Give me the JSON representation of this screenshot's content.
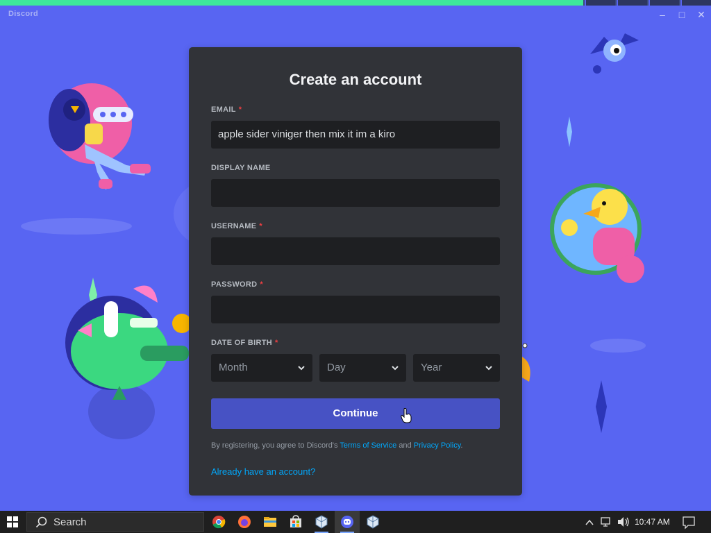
{
  "app": {
    "name": "Discord"
  },
  "form": {
    "title": "Create an account",
    "email": {
      "label": "EMAIL",
      "required_mark": "*",
      "value": "apple sider viniger then mix it im a kiro"
    },
    "display_name": {
      "label": "DISPLAY NAME",
      "value": ""
    },
    "username": {
      "label": "USERNAME",
      "required_mark": "*",
      "value": ""
    },
    "password": {
      "label": "PASSWORD",
      "required_mark": "*",
      "value": ""
    },
    "date_of_birth": {
      "label": "DATE OF BIRTH",
      "required_mark": "*",
      "month": "Month",
      "day": "Day",
      "year": "Year"
    },
    "continue_label": "Continue",
    "terms": {
      "prefix": "By registering, you agree to Discord's",
      "tos": "Terms of Service",
      "and": "and",
      "privacy": "Privacy Policy",
      "suffix": "."
    },
    "login_link": "Already have an account?"
  },
  "taskbar": {
    "search_label": "Search",
    "apps": [
      "chrome-icon",
      "firefox-icon",
      "file-explorer-icon",
      "store-icon",
      "virtualbox-icon",
      "discord-icon",
      "virtualbox-icon"
    ],
    "clock": "10:47 AM"
  },
  "colors": {
    "brand": "#5865f2",
    "modal": "#313338",
    "input": "#1e1f22",
    "button": "#4752c4",
    "link": "#00a8fc",
    "required": "#f23f42"
  }
}
